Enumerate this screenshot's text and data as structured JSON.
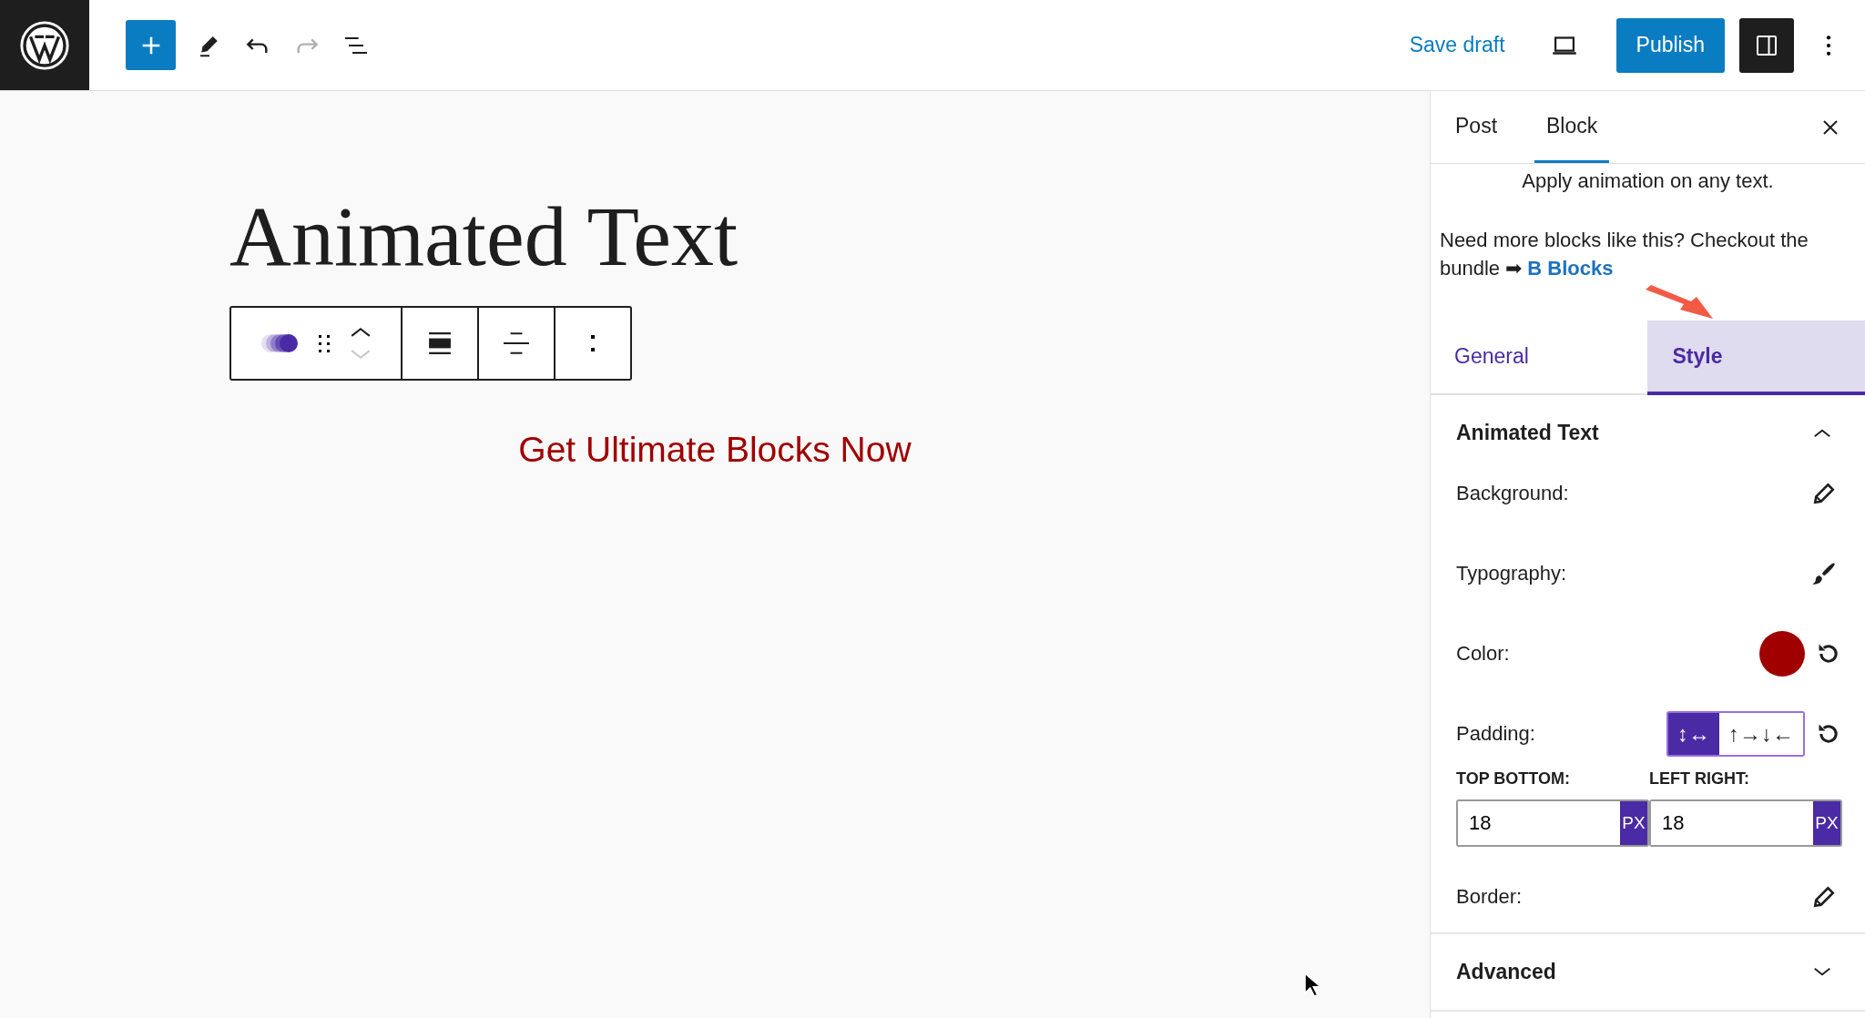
{
  "topbar": {
    "tools": [
      {
        "kind": "add",
        "disabled": false
      },
      {
        "kind": "edit",
        "disabled": false
      },
      {
        "kind": "undo",
        "disabled": false
      },
      {
        "kind": "redo",
        "disabled": true
      },
      {
        "kind": "list",
        "disabled": false
      }
    ],
    "save_draft": "Save draft",
    "publish": "Publish",
    "settings_panel_open": true
  },
  "editor": {
    "title": "Animated Text",
    "block_toolbar": {
      "move_up_disabled": false,
      "move_down_disabled": true
    },
    "link": "Get Ultimate Blocks Now"
  },
  "sidebar": {
    "tabs": [
      {
        "label": "Post",
        "selected": false
      },
      {
        "label": "Block",
        "selected": true
      }
    ],
    "description": "Apply animation on any text.",
    "promo": {
      "text": "Need more blocks like this? Checkout the bundle ➡",
      "link": "B Blocks"
    },
    "inner_tabs": [
      {
        "label": "General",
        "selected": false
      },
      {
        "label": "Style",
        "selected": true
      }
    ],
    "panels": [
      {
        "title": "Animated Text",
        "expanded": true,
        "rows": [
          {
            "kind": "edit",
            "label": "Background:"
          },
          {
            "kind": "brush",
            "label": "Typography:"
          },
          {
            "kind": "color",
            "label": "Color:",
            "color": "#a00000"
          },
          {
            "kind": "padding",
            "label": "Padding:",
            "modes": [
              {
                "label": "↕↔",
                "selected": true
              },
              {
                "label": "↑→↓←",
                "selected": false
              }
            ],
            "fields": [
              {
                "label": "TOP BOTTOM:",
                "value": "18",
                "unit": "PX"
              },
              {
                "label": "LEFT RIGHT:",
                "value": "18",
                "unit": "PX"
              }
            ]
          },
          {
            "kind": "edit",
            "label": "Border:"
          }
        ]
      },
      {
        "title": "Advanced",
        "expanded": false
      }
    ]
  }
}
